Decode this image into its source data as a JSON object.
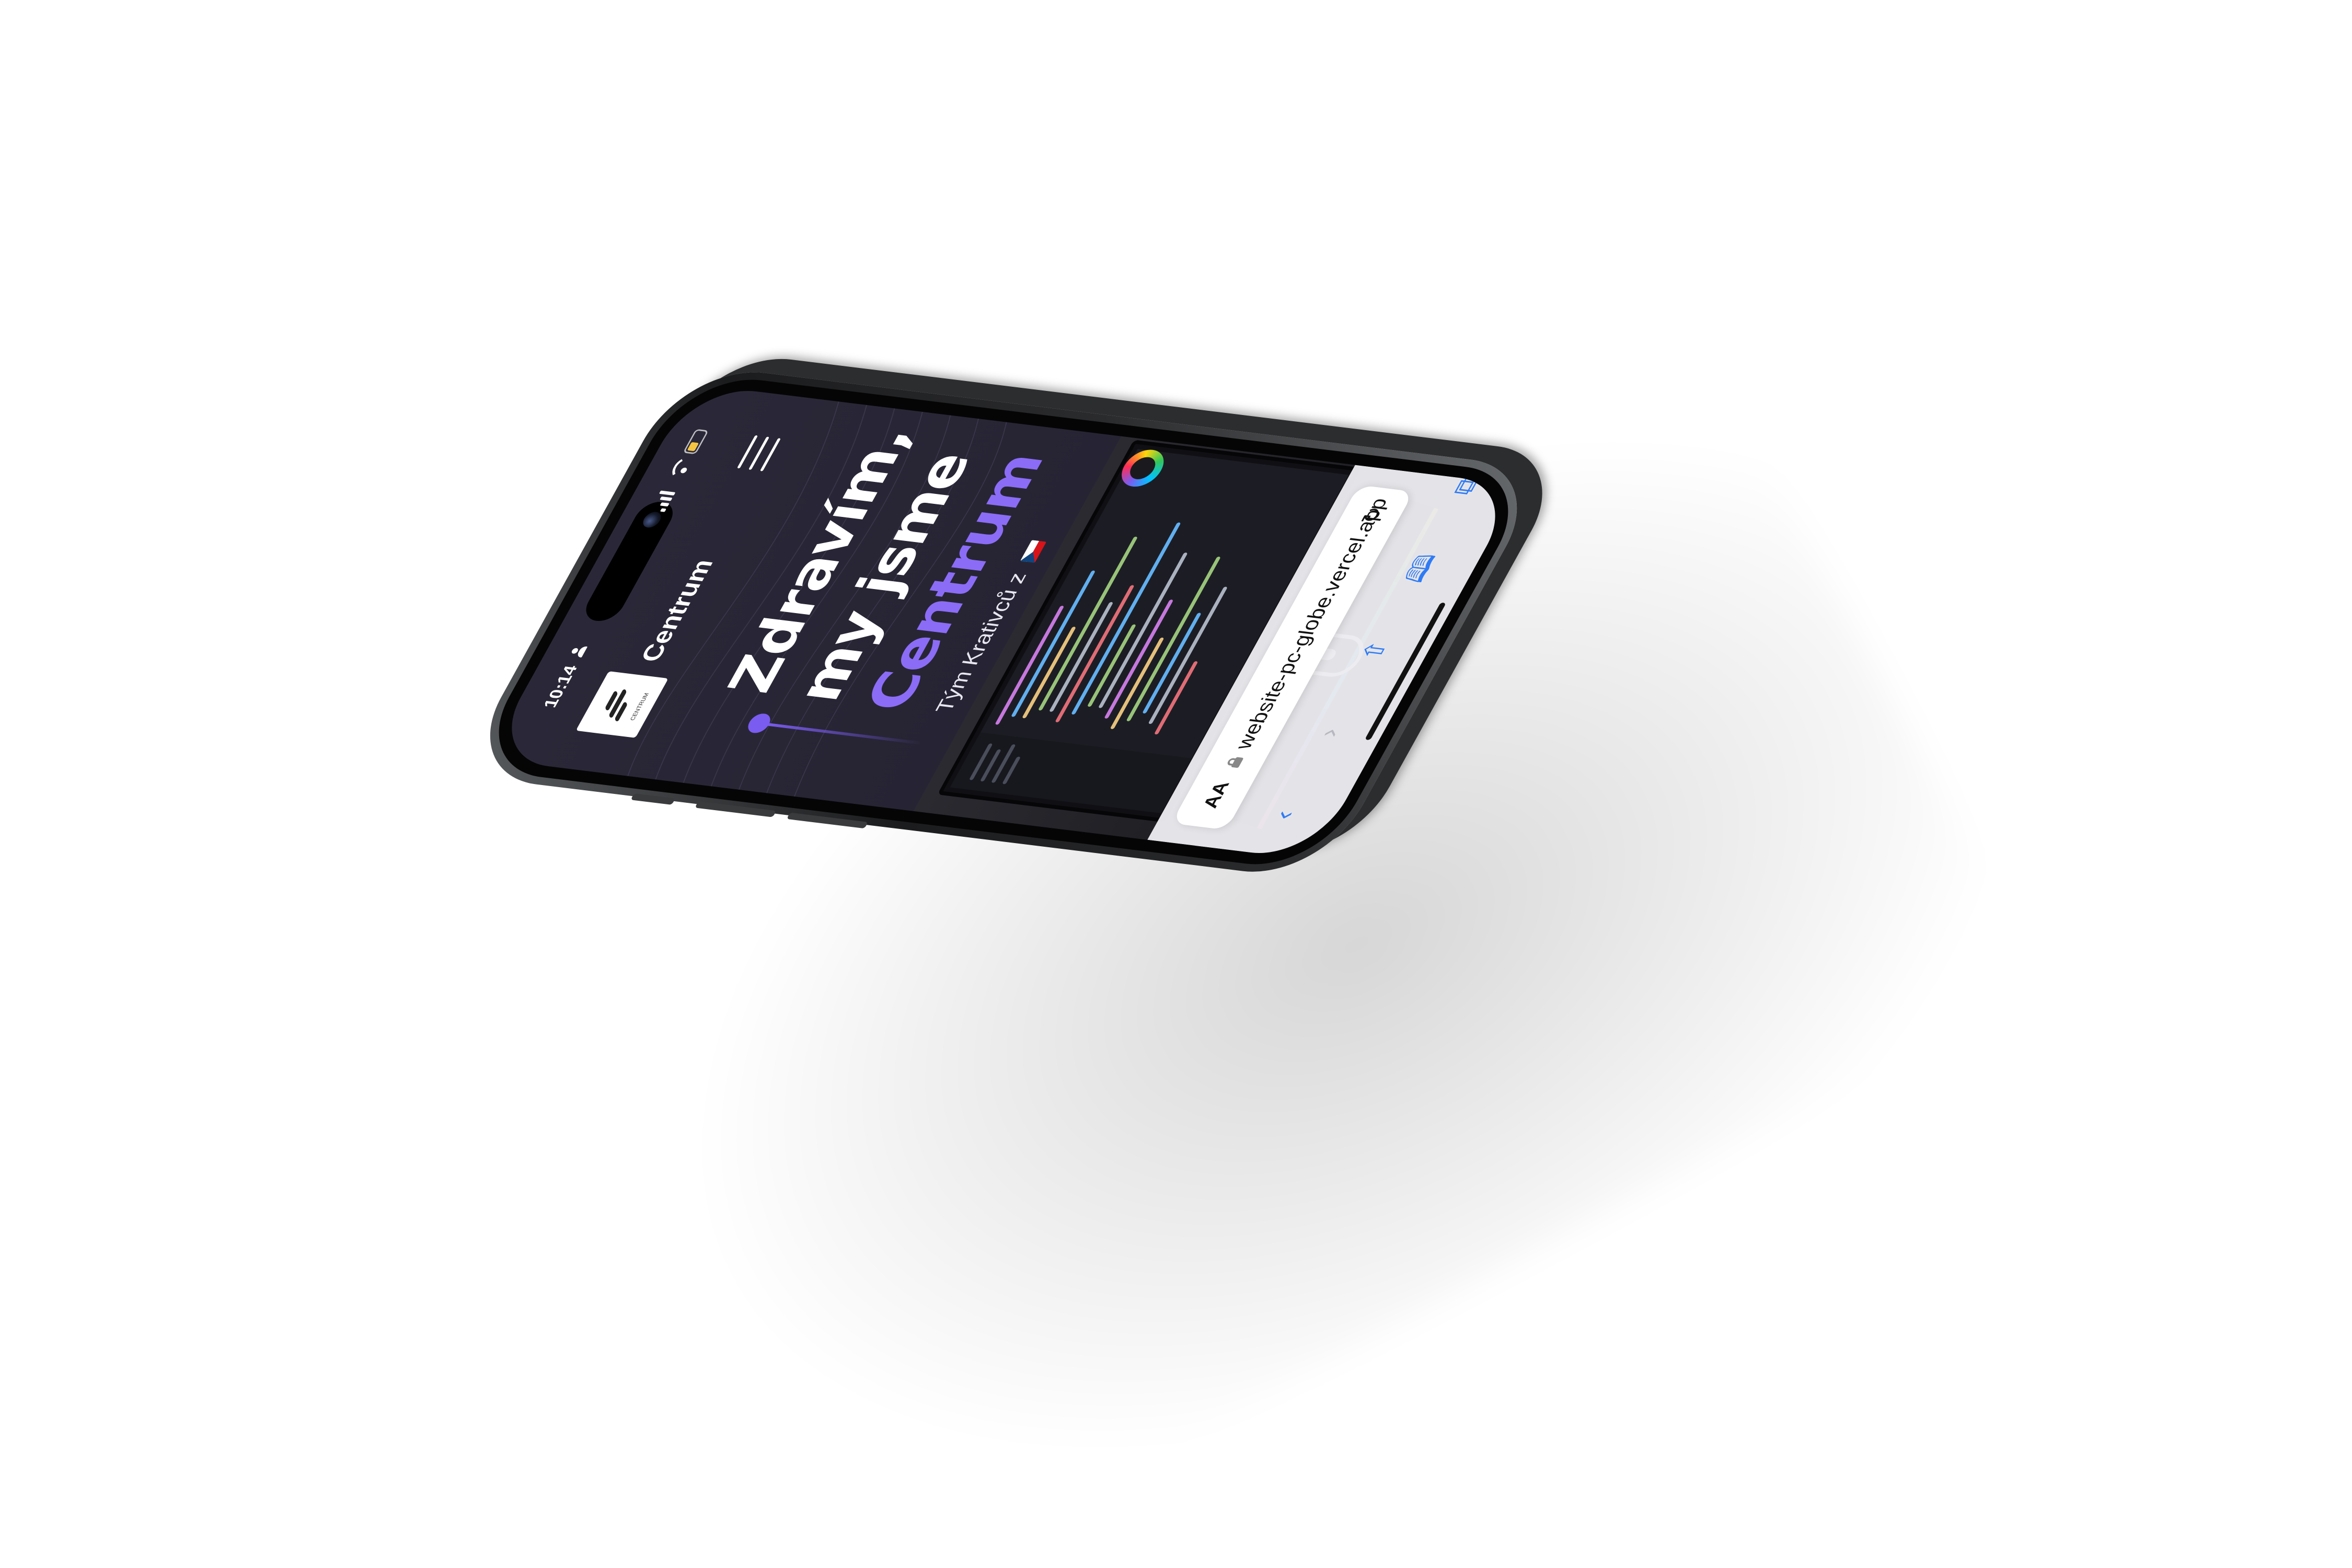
{
  "status_bar": {
    "time": "10:14",
    "icons": [
      "person-icon",
      "signal-icon",
      "wifi-icon",
      "battery-icon"
    ]
  },
  "site": {
    "brand_name": "Centrum",
    "logo_subtext": "CENTRUM"
  },
  "hero": {
    "title_line1": "Zdravím,",
    "title_line2": "my jsme",
    "title_accent": "Centrum",
    "subtitle": "Tým Krativců z"
  },
  "browser": {
    "aa_label": "AA",
    "url": "website-pc-globe.vercel.app",
    "toolbar": [
      "back-icon",
      "forward-icon",
      "share-icon",
      "bookmarks-icon",
      "tabs-icon"
    ]
  },
  "colors": {
    "accent": "#8b6cf6",
    "background": "#262433",
    "link_blue": "#2f7bf5"
  }
}
